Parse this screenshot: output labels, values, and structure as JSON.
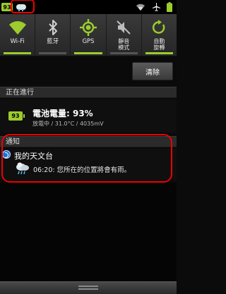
{
  "status_bar": {
    "battery_level": "93",
    "icons": [
      "battery-icon",
      "weather-icon",
      "wifi-icon",
      "airplane-icon",
      "battery-full-icon"
    ]
  },
  "quick_settings": {
    "tiles": [
      {
        "label": "Wi-Fi",
        "icon": "wifi-icon",
        "active": true
      },
      {
        "label": "藍牙",
        "icon": "bluetooth-icon",
        "active": false
      },
      {
        "label": "GPS",
        "icon": "gps-icon",
        "active": true
      },
      {
        "label": "靜音\n模式",
        "icon": "mute-icon",
        "active": false
      },
      {
        "label": "自動\n旋轉",
        "icon": "rotate-icon",
        "active": true
      }
    ]
  },
  "clear_button": {
    "label": "清除"
  },
  "sections": {
    "ongoing": "正在進行",
    "notifications": "通知"
  },
  "ongoing_item": {
    "battery_badge": "93",
    "title": "電池電量: 93%",
    "subtitle": "放電中 / 31.0°C / 4035mV"
  },
  "notification": {
    "app_name": "我的天文台",
    "time": "06:20:",
    "message": "您所在的位置將會有雨。",
    "full_text": "06:20: 您所在的位置將會有雨。"
  },
  "colors": {
    "accent": "#9ccc2e",
    "highlight_red": "#e00000"
  }
}
